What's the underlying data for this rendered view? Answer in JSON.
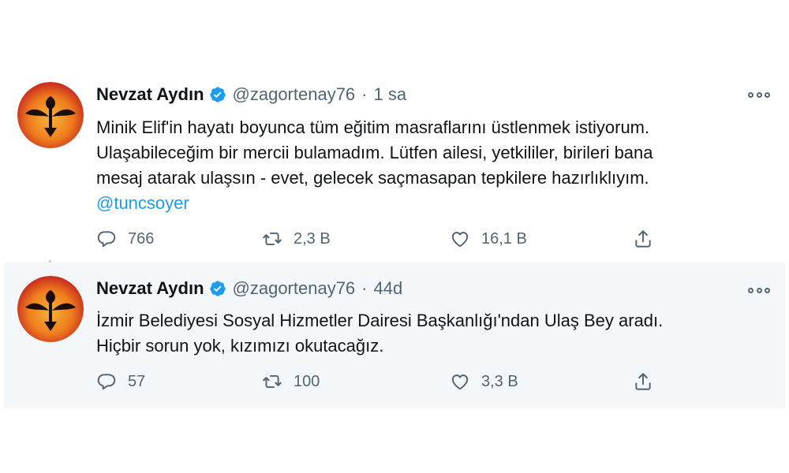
{
  "tweets": [
    {
      "author_name": "Nevzat Aydın",
      "handle": "@zagortenay76",
      "separator": "·",
      "time": "1 sa",
      "lines": [
        "Minik Elif'in hayatı boyunca tüm eğitim masraflarını üstlenmek istiyorum.",
        "Ulaşabileceğim bir mercii bulamadım. Lütfen ailesi, yetkililer, birileri bana",
        "mesaj atarak ulaşsın - evet, gelecek saçmasapan tepkilere hazırlıklıyım."
      ],
      "mention": "@tuncsoyer",
      "replies": "766",
      "retweets": "2,3 B",
      "likes": "16,1 B"
    },
    {
      "author_name": "Nevzat Aydın",
      "handle": "@zagortenay76",
      "separator": "·",
      "time": "44d",
      "lines": [
        "İzmir Belediyesi Sosyal Hizmetler Dairesi Başkanlığı'ndan Ulaş Bey aradı.",
        "Hiçbir sorun yok, kızımızı okutacağız."
      ],
      "replies": "57",
      "retweets": "100",
      "likes": "3,3 B"
    }
  ],
  "icons": {
    "verified": "verified-badge-icon",
    "more": "more-options-icon",
    "reply": "reply-icon",
    "retweet": "retweet-icon",
    "like": "heart-icon",
    "share": "share-icon"
  },
  "colors": {
    "verified": "#1d9bf0",
    "mention": "#1d9bf0",
    "secondary_text": "#536471",
    "thread_line": "#c4cfd6",
    "highlight_bg": "#f5f8fa",
    "avatar_orange": "#f07f1e",
    "avatar_red": "#d8322a"
  }
}
